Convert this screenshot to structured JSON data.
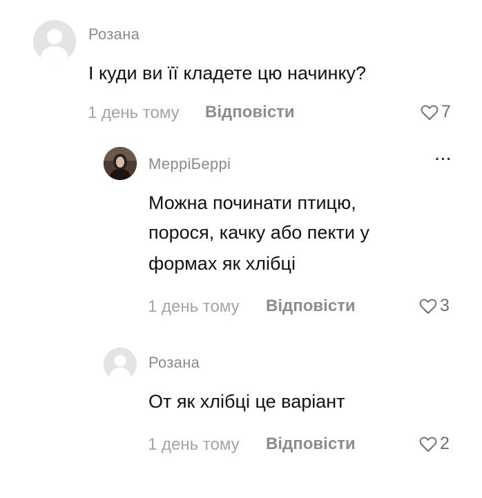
{
  "comments": [
    {
      "author": "Розана",
      "text": "І куди ви її кладете цю начинку?",
      "time": "1 день тому",
      "reply_label": "Відповісти",
      "likes": "7",
      "avatar": "default-avatar-icon"
    },
    {
      "author": "МерріБеррі",
      "text_lines": [
        "Можна починати птицю,",
        "порося, качку або пекти у",
        "формах як хлібці"
      ],
      "time": "1 день тому",
      "reply_label": "Відповісти",
      "likes": "3",
      "avatar": "user-photo",
      "more_label": "···"
    },
    {
      "author": "Розана",
      "text": "От як хлібці це варіант",
      "time": "1 день тому",
      "reply_label": "Відповісти",
      "likes": "2",
      "avatar": "default-avatar-icon"
    }
  ],
  "colors": {
    "author": "#8a8a8a",
    "meta": "#a4a4a4",
    "reply": "#8c8c8c",
    "text": "#111111"
  }
}
